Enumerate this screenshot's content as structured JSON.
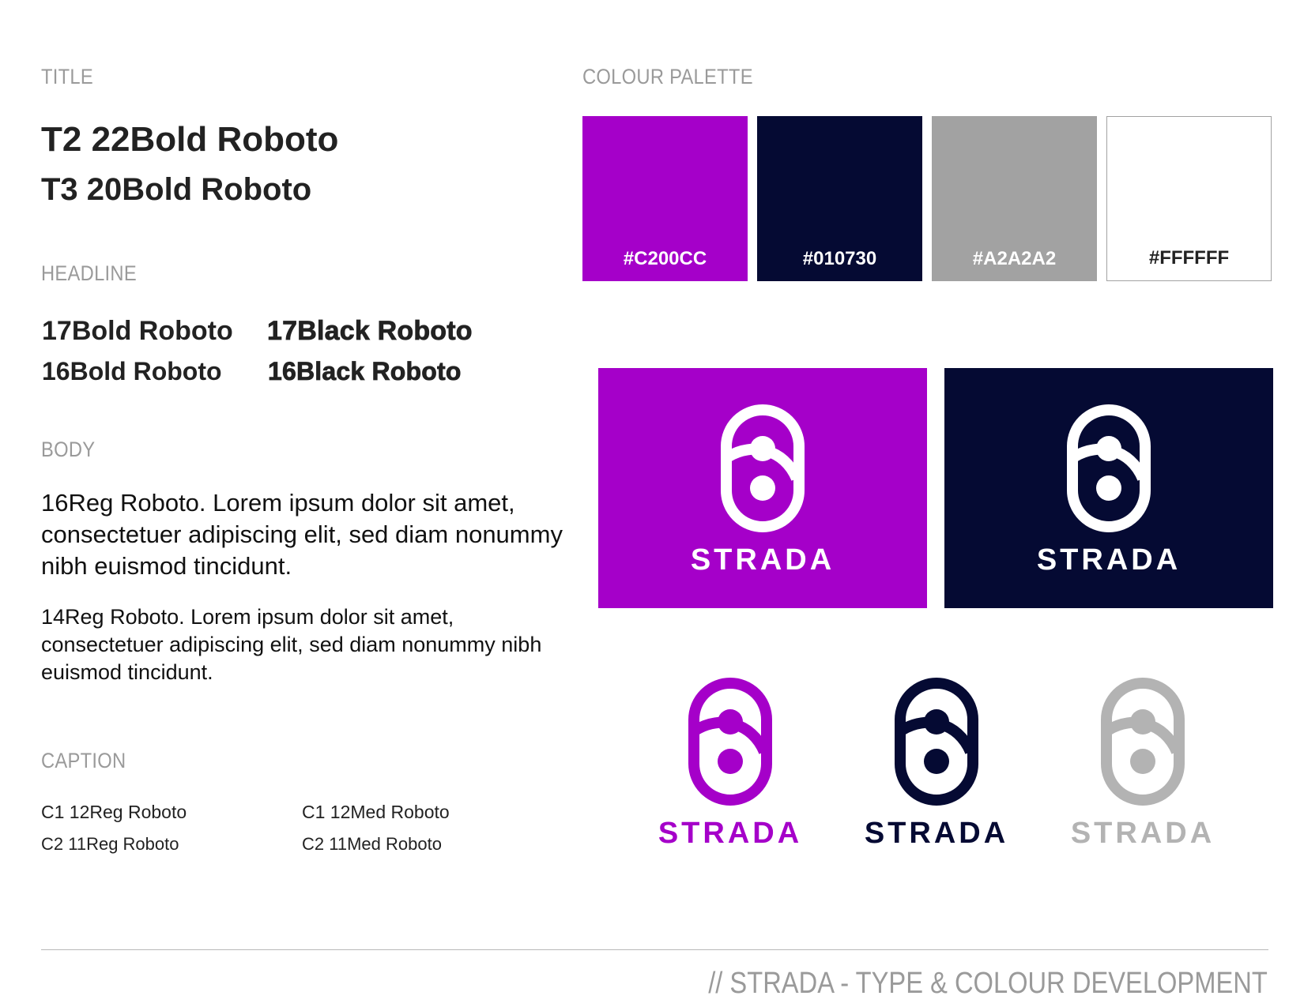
{
  "labels": {
    "title": "TITLE",
    "headline": "HEADLINE",
    "body": "BODY",
    "caption": "CAPTION",
    "palette": "COLOUR PALETTE"
  },
  "title_samples": {
    "t2": "T2 22Bold Roboto",
    "t3": "T3 20Bold Roboto"
  },
  "headline_samples": {
    "bold17": "17Bold Roboto",
    "black17": "17Black Roboto",
    "bold16": "16Bold Roboto",
    "black16": "16Black Roboto"
  },
  "body_samples": {
    "reg16": "16Reg Roboto. Lorem ipsum dolor sit amet, consectetuer adipiscing elit, sed diam nonummy nibh euismod tincidunt.",
    "reg14": "14Reg Roboto. Lorem ipsum dolor sit amet, consectetuer adipiscing elit, sed diam nonummy nibh euismod tincidunt."
  },
  "caption_samples": {
    "c1_reg": "C1 12Reg Roboto",
    "c1_med": "C1 12Med Roboto",
    "c2_reg": "C2 11Reg Roboto",
    "c2_med": "C2 11Med Roboto"
  },
  "palette": [
    {
      "hex": "#C200CC",
      "fill": "#a500c9",
      "text_color": "#ffffff"
    },
    {
      "hex": "#010730",
      "fill": "#050a33",
      "text_color": "#ffffff"
    },
    {
      "hex": "#A2A2A2",
      "fill": "#a2a2a2",
      "text_color": "#ffffff"
    },
    {
      "hex": "#FFFFFF",
      "fill": "#ffffff",
      "text_color": "#222222"
    }
  ],
  "logo_panels": [
    {
      "wordmark": "STRADA",
      "background": "#a500c9",
      "mark_color": "#ffffff"
    },
    {
      "wordmark": "STRADA",
      "background": "#050a33",
      "mark_color": "#ffffff"
    }
  ],
  "logo_marks": [
    {
      "wordmark": "STRADA",
      "color": "#a500c9"
    },
    {
      "wordmark": "STRADA",
      "color": "#050a33"
    },
    {
      "wordmark": "STRADA",
      "color": "#b3b3b3"
    }
  ],
  "footer": "// STRADA - TYPE & COLOUR DEVELOPMENT"
}
